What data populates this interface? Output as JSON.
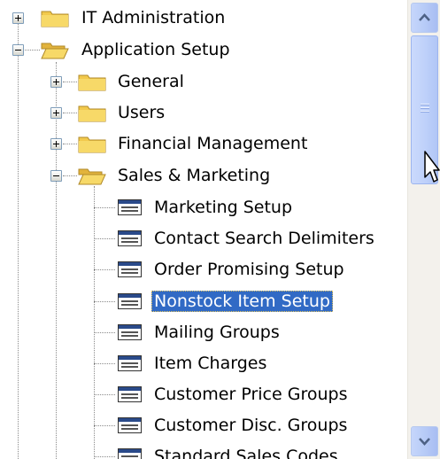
{
  "tree": {
    "items": [
      {
        "label": "IT Administration",
        "state": "collapsed",
        "folder": "closed"
      },
      {
        "label": "Application Setup",
        "state": "expanded",
        "folder": "open"
      },
      {
        "label": "General",
        "state": "collapsed",
        "folder": "closed"
      },
      {
        "label": "Users",
        "state": "collapsed",
        "folder": "closed"
      },
      {
        "label": "Financial Management",
        "state": "collapsed",
        "folder": "closed"
      },
      {
        "label": "Sales & Marketing",
        "state": "expanded",
        "folder": "open"
      },
      {
        "label": "Marketing Setup"
      },
      {
        "label": "Contact Search Delimiters"
      },
      {
        "label": "Order Promising Setup"
      },
      {
        "label": "Nonstock Item Setup",
        "selected": true
      },
      {
        "label": "Mailing Groups"
      },
      {
        "label": "Item Charges"
      },
      {
        "label": "Customer Price Groups"
      },
      {
        "label": "Customer Disc. Groups"
      },
      {
        "label": "Standard Sales Codes"
      }
    ]
  },
  "scrollbar": {
    "up_icon": "chevron-up-icon",
    "down_icon": "chevron-down-icon"
  },
  "colors": {
    "selection": "#316ac5",
    "folder": "#f2c94c",
    "scroll_accent": "#4d6185"
  }
}
